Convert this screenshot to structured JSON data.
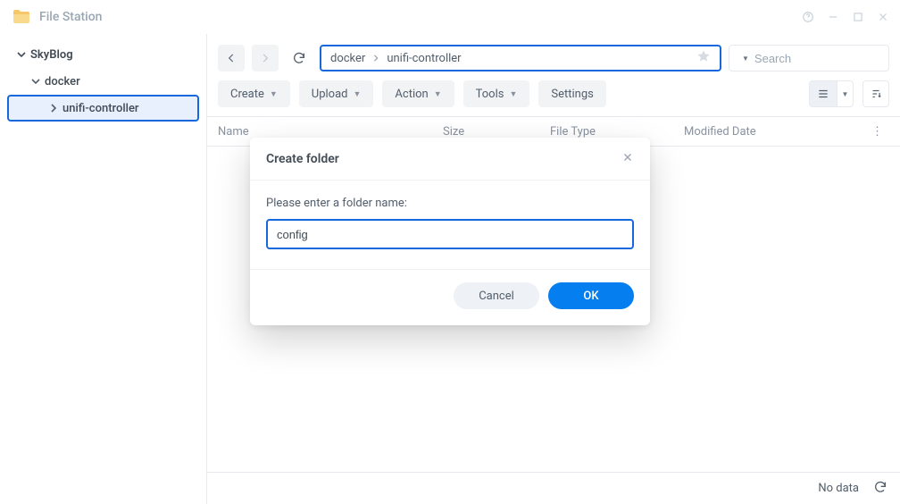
{
  "app": {
    "title": "File Station"
  },
  "sidebar": {
    "root": "SkyBlog",
    "items": [
      {
        "label": "docker"
      },
      {
        "label": "unifi-controller",
        "selected": true
      }
    ]
  },
  "nav": {
    "path": [
      "docker",
      "unifi-controller"
    ]
  },
  "search": {
    "placeholder": "Search"
  },
  "toolbar": {
    "create": "Create",
    "upload": "Upload",
    "action": "Action",
    "tools": "Tools",
    "settings": "Settings"
  },
  "columns": {
    "name": "Name",
    "size": "Size",
    "type": "File Type",
    "date": "Modified Date"
  },
  "status": {
    "empty": "No data"
  },
  "dialog": {
    "title": "Create folder",
    "prompt": "Please enter a folder name:",
    "value": "config",
    "ok": "OK",
    "cancel": "Cancel"
  }
}
